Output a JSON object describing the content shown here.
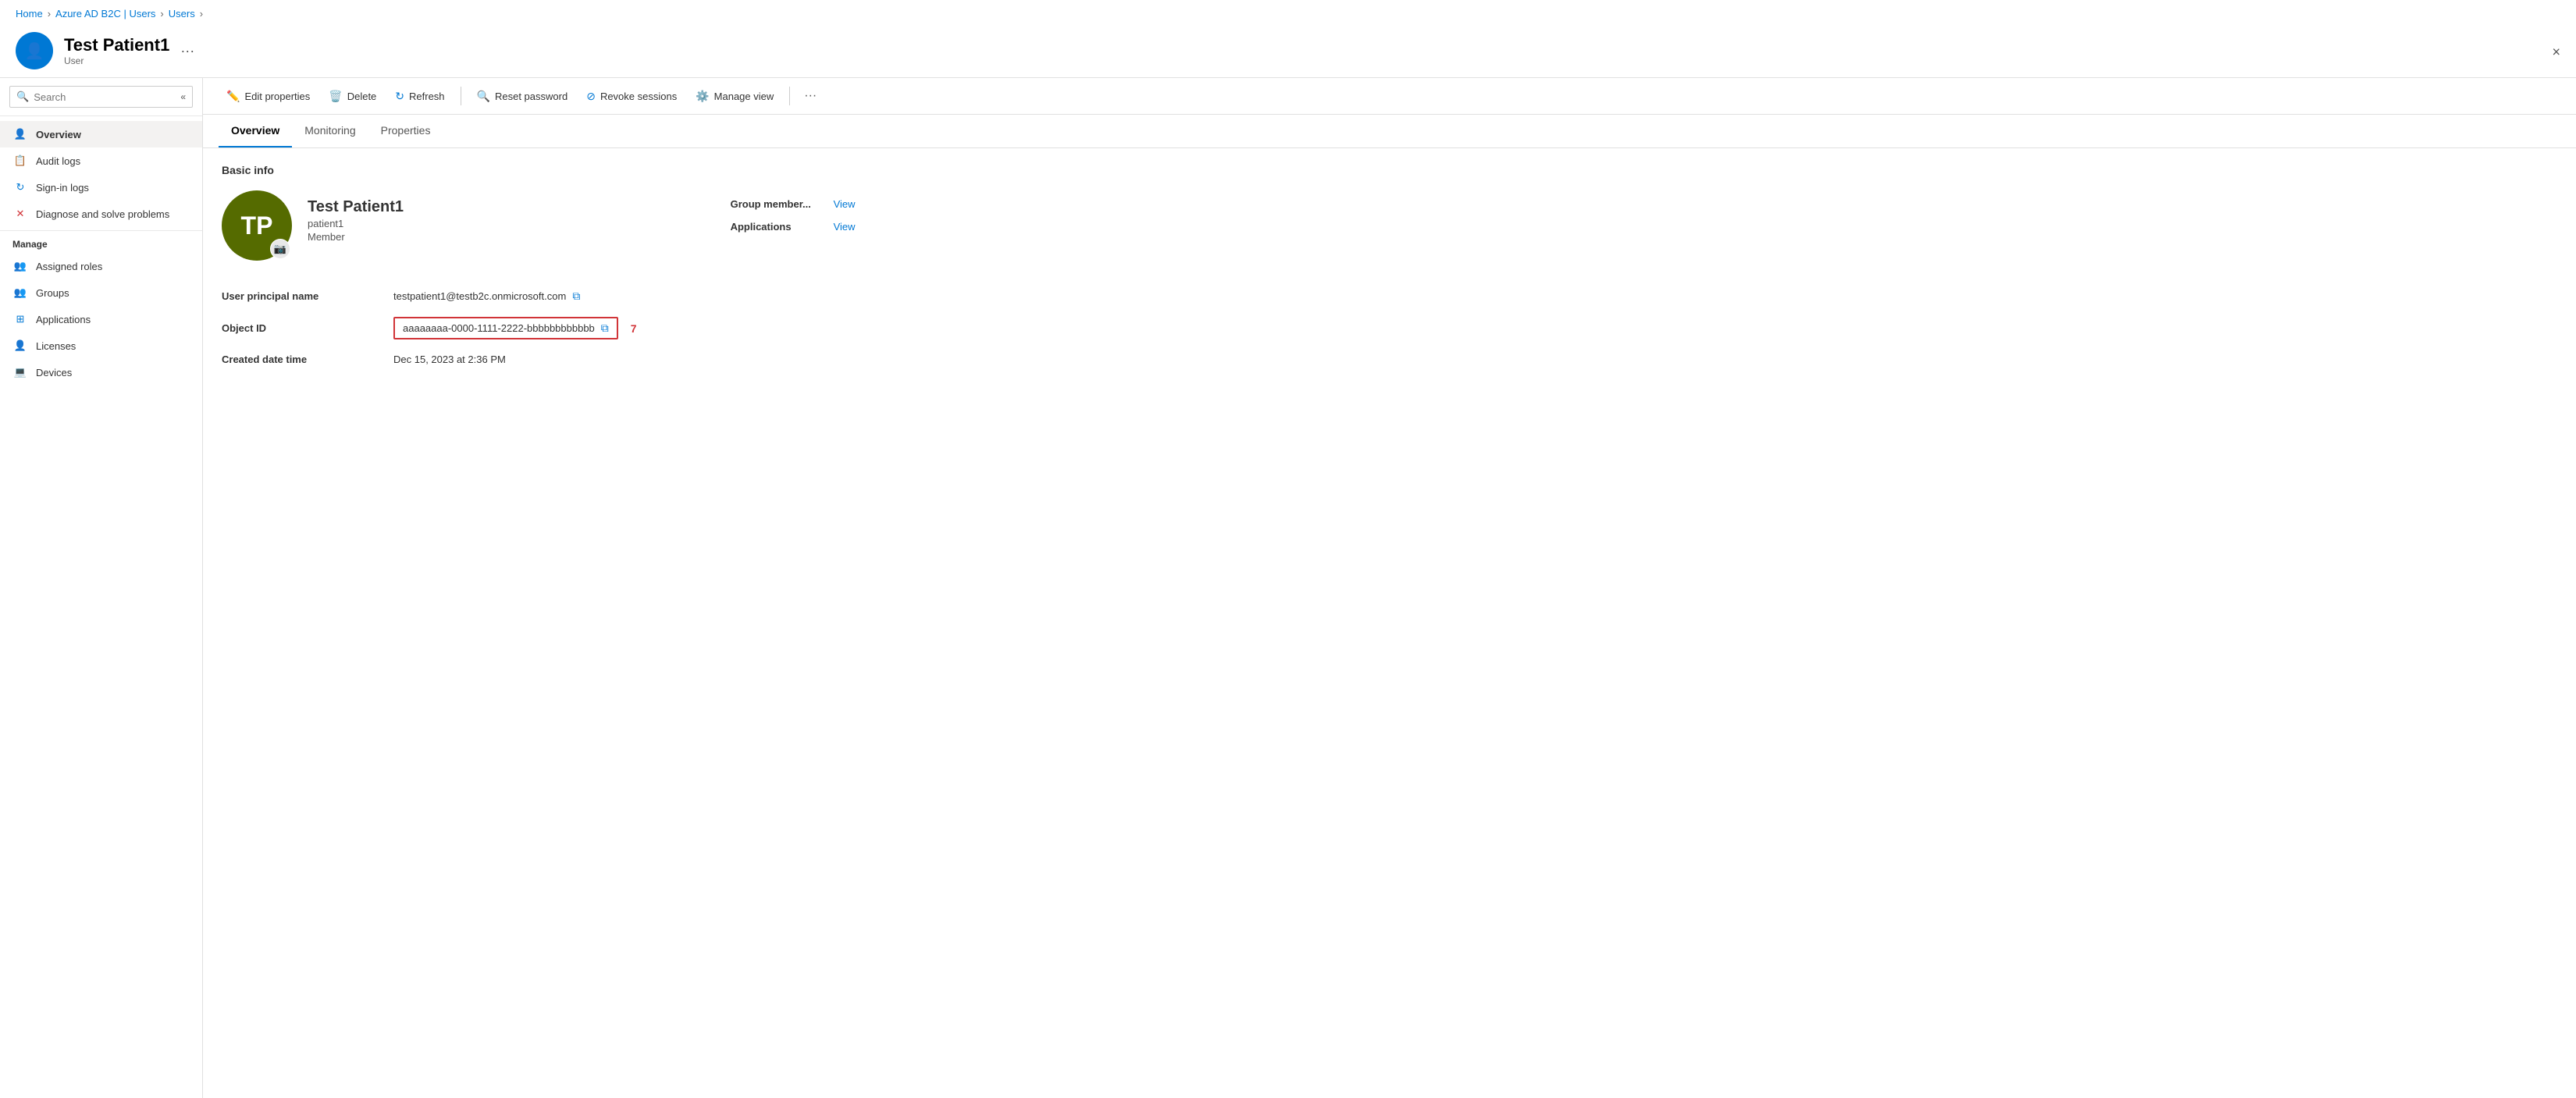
{
  "breadcrumb": {
    "items": [
      {
        "label": "Home",
        "link": true
      },
      {
        "label": "Azure AD B2C | Users",
        "link": true
      },
      {
        "label": "Users",
        "link": true
      }
    ]
  },
  "header": {
    "title": "Test Patient1",
    "subtitle": "User",
    "avatar_initials": "TP",
    "more_icon": "···",
    "close_icon": "×"
  },
  "sidebar": {
    "search_placeholder": "Search",
    "nav_items": [
      {
        "label": "Overview",
        "icon": "👤",
        "active": true,
        "section": null
      },
      {
        "label": "Audit logs",
        "icon": "📋",
        "active": false,
        "section": null
      },
      {
        "label": "Sign-in logs",
        "icon": "↻",
        "active": false,
        "section": null
      },
      {
        "label": "Diagnose and solve problems",
        "icon": "✕",
        "active": false,
        "section": null
      }
    ],
    "manage_section": "Manage",
    "manage_items": [
      {
        "label": "Assigned roles",
        "icon": "👥"
      },
      {
        "label": "Groups",
        "icon": "👥"
      },
      {
        "label": "Applications",
        "icon": "⊞"
      },
      {
        "label": "Licenses",
        "icon": "👤"
      },
      {
        "label": "Devices",
        "icon": "💻"
      }
    ]
  },
  "toolbar": {
    "buttons": [
      {
        "label": "Edit properties",
        "icon": "✏️"
      },
      {
        "label": "Delete",
        "icon": "🗑️"
      },
      {
        "label": "Refresh",
        "icon": "↻"
      },
      {
        "label": "Reset password",
        "icon": "🔍"
      },
      {
        "label": "Revoke sessions",
        "icon": "⊘"
      },
      {
        "label": "Manage view",
        "icon": "⚙️"
      }
    ],
    "more_icon": "···"
  },
  "tabs": {
    "items": [
      {
        "label": "Overview",
        "active": true
      },
      {
        "label": "Monitoring",
        "active": false
      },
      {
        "label": "Properties",
        "active": false
      }
    ]
  },
  "content": {
    "section_title": "Basic info",
    "user": {
      "avatar_initials": "TP",
      "name": "Test Patient1",
      "username": "patient1",
      "role": "Member"
    },
    "fields": [
      {
        "label": "User principal name",
        "value": "testpatient1@testb2c.onmicrosoft.com",
        "has_copy": true,
        "highlighted": false
      },
      {
        "label": "Object ID",
        "value": "aaaaaaaa-0000-1111-2222-bbbbbbbbbbbb",
        "has_copy": true,
        "highlighted": true,
        "extra": "7"
      },
      {
        "label": "Created date time",
        "value": "Dec 15, 2023 at 2:36 PM",
        "has_copy": false,
        "highlighted": false
      }
    ],
    "right_fields": [
      {
        "label": "Group member...",
        "link_label": "View"
      },
      {
        "label": "Applications",
        "link_label": "View"
      }
    ]
  }
}
